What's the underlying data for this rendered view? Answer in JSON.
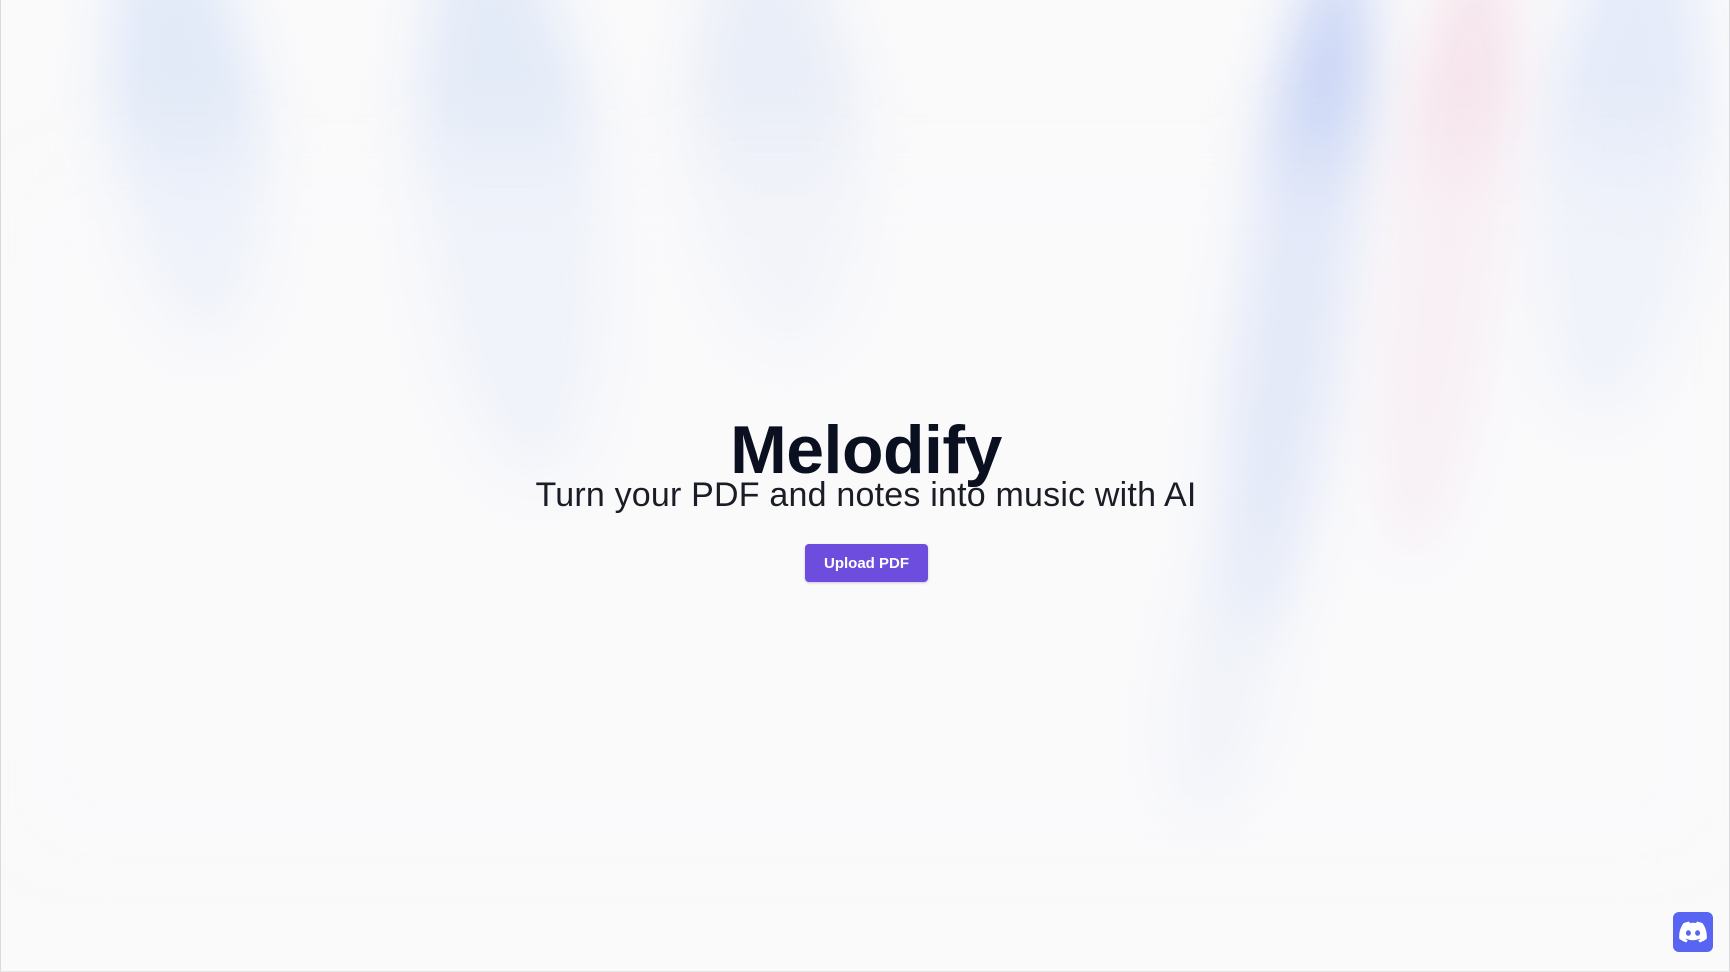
{
  "hero": {
    "title": "Melodify",
    "subtitle": "Turn your PDF and notes into music with AI",
    "upload_button_label": "Upload PDF"
  },
  "floating_actions": {
    "discord_icon": "discord-icon"
  },
  "colors": {
    "accent": "#6d4dde",
    "discord": "#5865f2",
    "title": "#0b1020",
    "background": "#fafafb"
  }
}
